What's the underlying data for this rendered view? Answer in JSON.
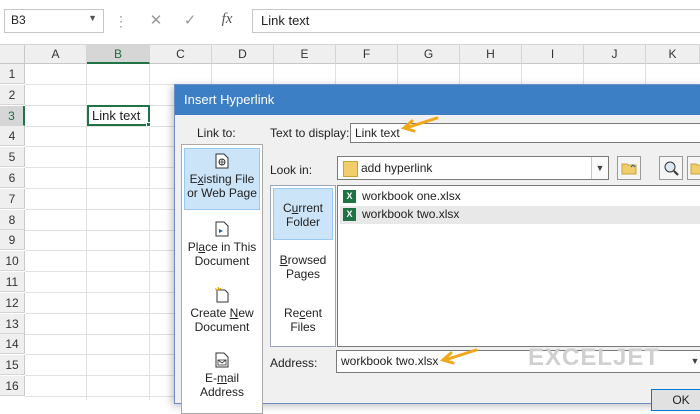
{
  "formula_bar": {
    "name_box": "B3",
    "cancel_icon": "✕",
    "enter_icon": "✓",
    "fx_label": "fx",
    "formula": "Link text"
  },
  "grid": {
    "columns": [
      "A",
      "B",
      "C",
      "D",
      "E",
      "F",
      "G",
      "H",
      "I",
      "J",
      "K"
    ],
    "selected_column": "B",
    "rows": [
      "1",
      "2",
      "3",
      "4",
      "5",
      "6",
      "7",
      "8",
      "9",
      "10",
      "11",
      "12",
      "13",
      "14",
      "15",
      "16"
    ],
    "selected_row": "3",
    "cell_b3": "Link text"
  },
  "dialog": {
    "title": "Insert Hyperlink",
    "link_to_label": "Link to:",
    "link_to_items": [
      {
        "pre": "E",
        "u": "x",
        "post": "isting File or Web Page",
        "icon": "existing-file-icon"
      },
      {
        "pre": "Pl",
        "u": "a",
        "post": "ce in This Document",
        "icon": "place-in-document-icon"
      },
      {
        "pre": "Create ",
        "u": "N",
        "post": "ew Document",
        "icon": "new-document-icon"
      },
      {
        "pre": "E-",
        "u": "m",
        "post": "ail Address",
        "icon": "email-icon"
      }
    ],
    "text_to_display_label": "Text to display:",
    "text_to_display_value": "Link text",
    "look_in_label": "Look in:",
    "look_in_value": "add hyperlink",
    "side_tabs": [
      {
        "pre": "C",
        "u": "u",
        "post": "rrent Folder"
      },
      {
        "pre": "",
        "u": "B",
        "post": "rowsed Pages"
      },
      {
        "pre": "Re",
        "u": "c",
        "post": "ent Files"
      }
    ],
    "files": [
      "workbook one.xlsx",
      "workbook two.xlsx"
    ],
    "address_label": "Address:",
    "address_value": "workbook two.xlsx",
    "ok_label": "OK",
    "accent_color": "#3c7fc4",
    "arrow_color": "#f0a818"
  },
  "watermark": "EXCELJET"
}
